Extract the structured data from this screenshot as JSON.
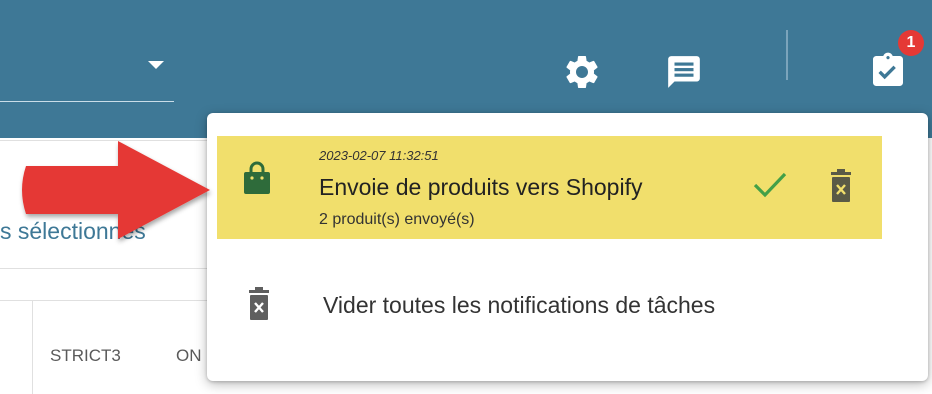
{
  "header": {
    "badge_count": "1",
    "icons": [
      "chevron-down-icon",
      "gear-icon",
      "message-icon",
      "task-clipboard-icon"
    ]
  },
  "background": {
    "link_text": "s sélectionnés",
    "columns": [
      "STRICT3",
      "ON"
    ]
  },
  "notifications": {
    "items": [
      {
        "timestamp": "2023-02-07 11:32:51",
        "title": "Envoie de produits vers Shopify",
        "subtitle": "2 produit(s) envoyé(s)",
        "icon": "shopping-bag-icon",
        "status": "success",
        "highlight_color": "#f1df6c"
      }
    ],
    "clear_all_label": "Vider toutes les notifications de tâches"
  },
  "colors": {
    "header_bg": "#3e7896",
    "badge": "#e53935",
    "arrow": "#e53935",
    "success": "#43a047",
    "bag_icon": "#2e6b3a"
  }
}
